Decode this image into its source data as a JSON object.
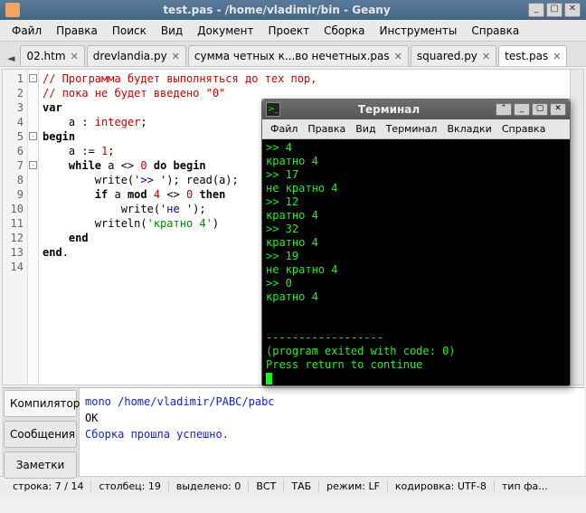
{
  "window": {
    "title": "test.pas - /home/vladimir/bin - Geany"
  },
  "menubar": [
    "Файл",
    "Правка",
    "Поиск",
    "Вид",
    "Документ",
    "Проект",
    "Сборка",
    "Инструменты",
    "Справка"
  ],
  "tabs": {
    "items": [
      {
        "label": "02.htm",
        "active": false
      },
      {
        "label": "drevlandia.py",
        "active": false
      },
      {
        "label": "сумма четных к...во нечетных.pas",
        "active": false
      },
      {
        "label": "squared.py",
        "active": false
      },
      {
        "label": "test.pas",
        "active": true
      }
    ]
  },
  "code": {
    "lines": [
      {
        "n": 1,
        "fold": "-",
        "html": "<span class='c-comment'>// Программа будет выполняться до тех пор,</span>"
      },
      {
        "n": 2,
        "fold": "",
        "html": "<span class='c-comment'>// пока не будет введено \"0\"</span>"
      },
      {
        "n": 3,
        "fold": "",
        "html": "<span class='c-keyword'>var</span>"
      },
      {
        "n": 4,
        "fold": "",
        "html": "    a : <span class='c-type'>integer</span>;"
      },
      {
        "n": 5,
        "fold": "-",
        "html": "<span class='c-keyword'>begin</span>"
      },
      {
        "n": 6,
        "fold": "",
        "html": "    a := <span class='c-num'>1</span>;"
      },
      {
        "n": 7,
        "fold": "-",
        "html": "    <span class='c-keyword'>while</span> a &lt;&gt; <span class='c-num'>0</span> <span class='c-keyword'>do begin</span>"
      },
      {
        "n": 8,
        "fold": "",
        "html": "        write(<span class='c-str'>'&gt;&gt; '</span>); read(a);"
      },
      {
        "n": 9,
        "fold": "",
        "html": "        <span class='c-keyword'>if</span> a <span class='c-keyword'>mod</span> <span class='c-num'>4</span> &lt;&gt; <span class='c-num'>0</span> <span class='c-keyword'>then</span>"
      },
      {
        "n": 10,
        "fold": "",
        "html": "            write(<span class='c-str'>'не '</span>);"
      },
      {
        "n": 11,
        "fold": "",
        "html": "        writeln(<span class='c-green'>'кратно 4'</span>)"
      },
      {
        "n": 12,
        "fold": "",
        "html": "    <span class='c-keyword'>end</span>"
      },
      {
        "n": 13,
        "fold": "",
        "html": "<span class='c-keyword'>end</span>."
      },
      {
        "n": 14,
        "fold": "",
        "html": ""
      }
    ]
  },
  "terminal": {
    "title": "Терминал",
    "menubar": [
      "Файл",
      "Правка",
      "Вид",
      "Терминал",
      "Вкладки",
      "Справка"
    ],
    "lines": [
      ">> 4",
      "кратно 4",
      ">> 17",
      "не кратно 4",
      ">> 12",
      "кратно 4",
      ">> 32",
      "кратно 4",
      ">> 19",
      "не кратно 4",
      ">> 0",
      "кратно 4",
      "",
      "",
      "------------------",
      "(program exited with code: 0)",
      "Press return to continue"
    ]
  },
  "bottom": {
    "tabs": [
      {
        "label": "Компилятор",
        "active": true
      },
      {
        "label": "Сообщения",
        "active": false
      },
      {
        "label": "Заметки",
        "active": false
      }
    ],
    "messages": [
      {
        "text": "mono /home/vladimir/PABC/pabc",
        "cls": "msg-line"
      },
      {
        "text": "OK",
        "cls": ""
      },
      {
        "text": "Сборка прошла успешно.",
        "cls": "msg-line"
      }
    ]
  },
  "statusbar": {
    "line": "строка: 7 / 14",
    "col": "столбец: 19",
    "sel": "выделено: 0",
    "ins": "ВСТ",
    "tab": "ТАБ",
    "mode": "режим: LF",
    "enc": "кодировка: UTF-8",
    "ft": "тип фа..."
  }
}
